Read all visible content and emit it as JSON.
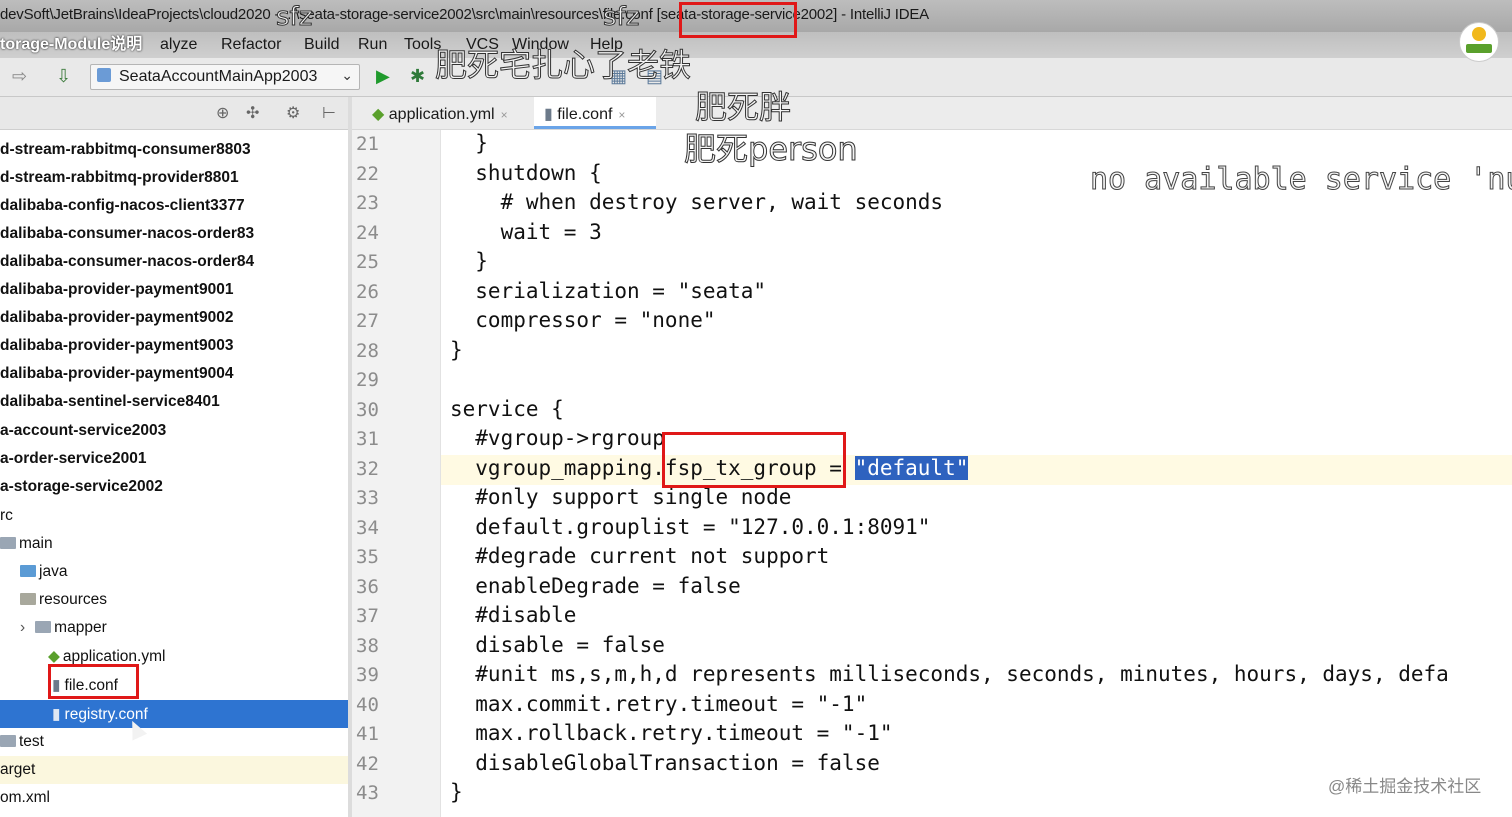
{
  "window": {
    "title": "devSoft\\JetBrains\\IdeaProjects\\cloud2020 - ...\\seata-storage-service2002\\src\\main\\resources\\file.conf [seata-storage-service2002] - IntelliJ IDEA",
    "video_title": "torage-Module说明"
  },
  "menu": [
    "alyze",
    "Refactor",
    "Build",
    "Run",
    "Tools",
    "VCS",
    "Window",
    "Help"
  ],
  "toolbar": {
    "run_config": "SeataAccountMainApp2003",
    "icons": [
      "back-icon",
      "build-icon",
      "run-icon",
      "debug-icon",
      "coverage-icon",
      "profile-icon"
    ]
  },
  "tabs": [
    {
      "label": "application.yml",
      "active": false
    },
    {
      "label": "file.conf",
      "active": true
    }
  ],
  "tree": {
    "rows": [
      {
        "label": "d-stream-rabbitmq-consumer8803",
        "kind": "module"
      },
      {
        "label": "d-stream-rabbitmq-provider8801",
        "kind": "module"
      },
      {
        "label": "dalibaba-config-nacos-client3377",
        "kind": "module"
      },
      {
        "label": "dalibaba-consumer-nacos-order83",
        "kind": "module"
      },
      {
        "label": "dalibaba-consumer-nacos-order84",
        "kind": "module"
      },
      {
        "label": "dalibaba-provider-payment9001",
        "kind": "module"
      },
      {
        "label": "dalibaba-provider-payment9002",
        "kind": "module"
      },
      {
        "label": "dalibaba-provider-payment9003",
        "kind": "module"
      },
      {
        "label": "dalibaba-provider-payment9004",
        "kind": "module"
      },
      {
        "label": "dalibaba-sentinel-service8401",
        "kind": "module"
      },
      {
        "label": "a-account-service2003",
        "kind": "module"
      },
      {
        "label": "a-order-service2001",
        "kind": "module"
      },
      {
        "label": "a-storage-service2002",
        "kind": "module"
      },
      {
        "label": "rc",
        "kind": "folder"
      },
      {
        "label": "main",
        "kind": "folder"
      },
      {
        "label": "java",
        "kind": "folder"
      },
      {
        "label": "resources",
        "kind": "folder"
      },
      {
        "label": "mapper",
        "kind": "folder"
      },
      {
        "label": "application.yml",
        "kind": "file"
      },
      {
        "label": "file.conf",
        "kind": "file"
      },
      {
        "label": "registry.conf",
        "kind": "file"
      },
      {
        "label": "test",
        "kind": "folder"
      },
      {
        "label": "arget",
        "kind": "folder"
      },
      {
        "label": "om.xml",
        "kind": "file"
      }
    ],
    "selected": "registry.conf"
  },
  "editor": {
    "lines": [
      {
        "no": "21",
        "text": "  }"
      },
      {
        "no": "22",
        "text": "  shutdown {"
      },
      {
        "no": "23",
        "text": "    # when destroy server, wait seconds"
      },
      {
        "no": "24",
        "text": "    wait = 3"
      },
      {
        "no": "25",
        "text": "  }"
      },
      {
        "no": "26",
        "text": "  serialization = \"seata\""
      },
      {
        "no": "27",
        "text": "  compressor = \"none\""
      },
      {
        "no": "28",
        "text": "}"
      },
      {
        "no": "29",
        "text": ""
      },
      {
        "no": "30",
        "text": "service {"
      },
      {
        "no": "31",
        "text": "  #vgroup->rgroup"
      },
      {
        "no": "32",
        "text": "  vgroup_mapping.fsp_tx_group = "
      },
      {
        "no": "33",
        "text": "  #only support single node"
      },
      {
        "no": "34",
        "text": "  default.grouplist = \"127.0.0.1:8091\""
      },
      {
        "no": "35",
        "text": "  #degrade current not support"
      },
      {
        "no": "36",
        "text": "  enableDegrade = false"
      },
      {
        "no": "37",
        "text": "  #disable"
      },
      {
        "no": "38",
        "text": "  disable = false"
      },
      {
        "no": "39",
        "text": "  #unit ms,s,m,h,d represents milliseconds, seconds, minutes, hours, days, defa"
      },
      {
        "no": "40",
        "text": "  max.commit.retry.timeout = \"-1\""
      },
      {
        "no": "41",
        "text": "  max.rollback.retry.timeout = \"-1\""
      },
      {
        "no": "42",
        "text": "  disableGlobalTransaction = false"
      },
      {
        "no": "43",
        "text": "}"
      }
    ],
    "selected_value": "\"default\""
  },
  "overlays": {
    "sfz_1": "sfz",
    "sfz_2": "sfz",
    "line_a": "肥死宅扎心了老铁",
    "line_b": "肥死胖",
    "line_c": "肥死person",
    "danmaku": "no available service 'nu"
  },
  "watermark": "@稀土掘金技术社区",
  "colors": {
    "selection": "#2e74d1",
    "highlight_box": "#e01818",
    "current_line": "#fffae3"
  }
}
